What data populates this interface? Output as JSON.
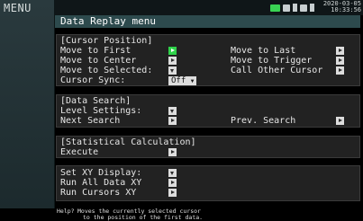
{
  "sidebar": {
    "title": "MENU"
  },
  "status": {
    "date": "2020-03-05",
    "time": "10:33:56",
    "battery_color": "#39d353"
  },
  "menu": {
    "title": "Data Replay menu"
  },
  "cursor_position": {
    "header": "[Cursor Position]",
    "move_first": "Move to First",
    "move_center": "Move to Center",
    "move_selected": "Move to Selected:",
    "cursor_sync": "Cursor Sync:",
    "cursor_sync_value": "Off",
    "move_last": "Move to Last",
    "move_trigger": "Move to Trigger",
    "call_other": "Call Other Cursor"
  },
  "data_search": {
    "header": "[Data Search]",
    "level_settings": "Level Settings:",
    "next_search": "Next Search",
    "prev_search": "Prev. Search"
  },
  "statistical": {
    "header": "[Statistical Calculation]",
    "execute": "Execute"
  },
  "xy": {
    "set_xy": "Set XY Display:",
    "run_all": "Run All Data XY",
    "run_cursors": "Run Cursors XY"
  },
  "help": {
    "label": "Help?",
    "line1": "Moves the currently selected cursor",
    "line2": "to the position of the first data."
  }
}
